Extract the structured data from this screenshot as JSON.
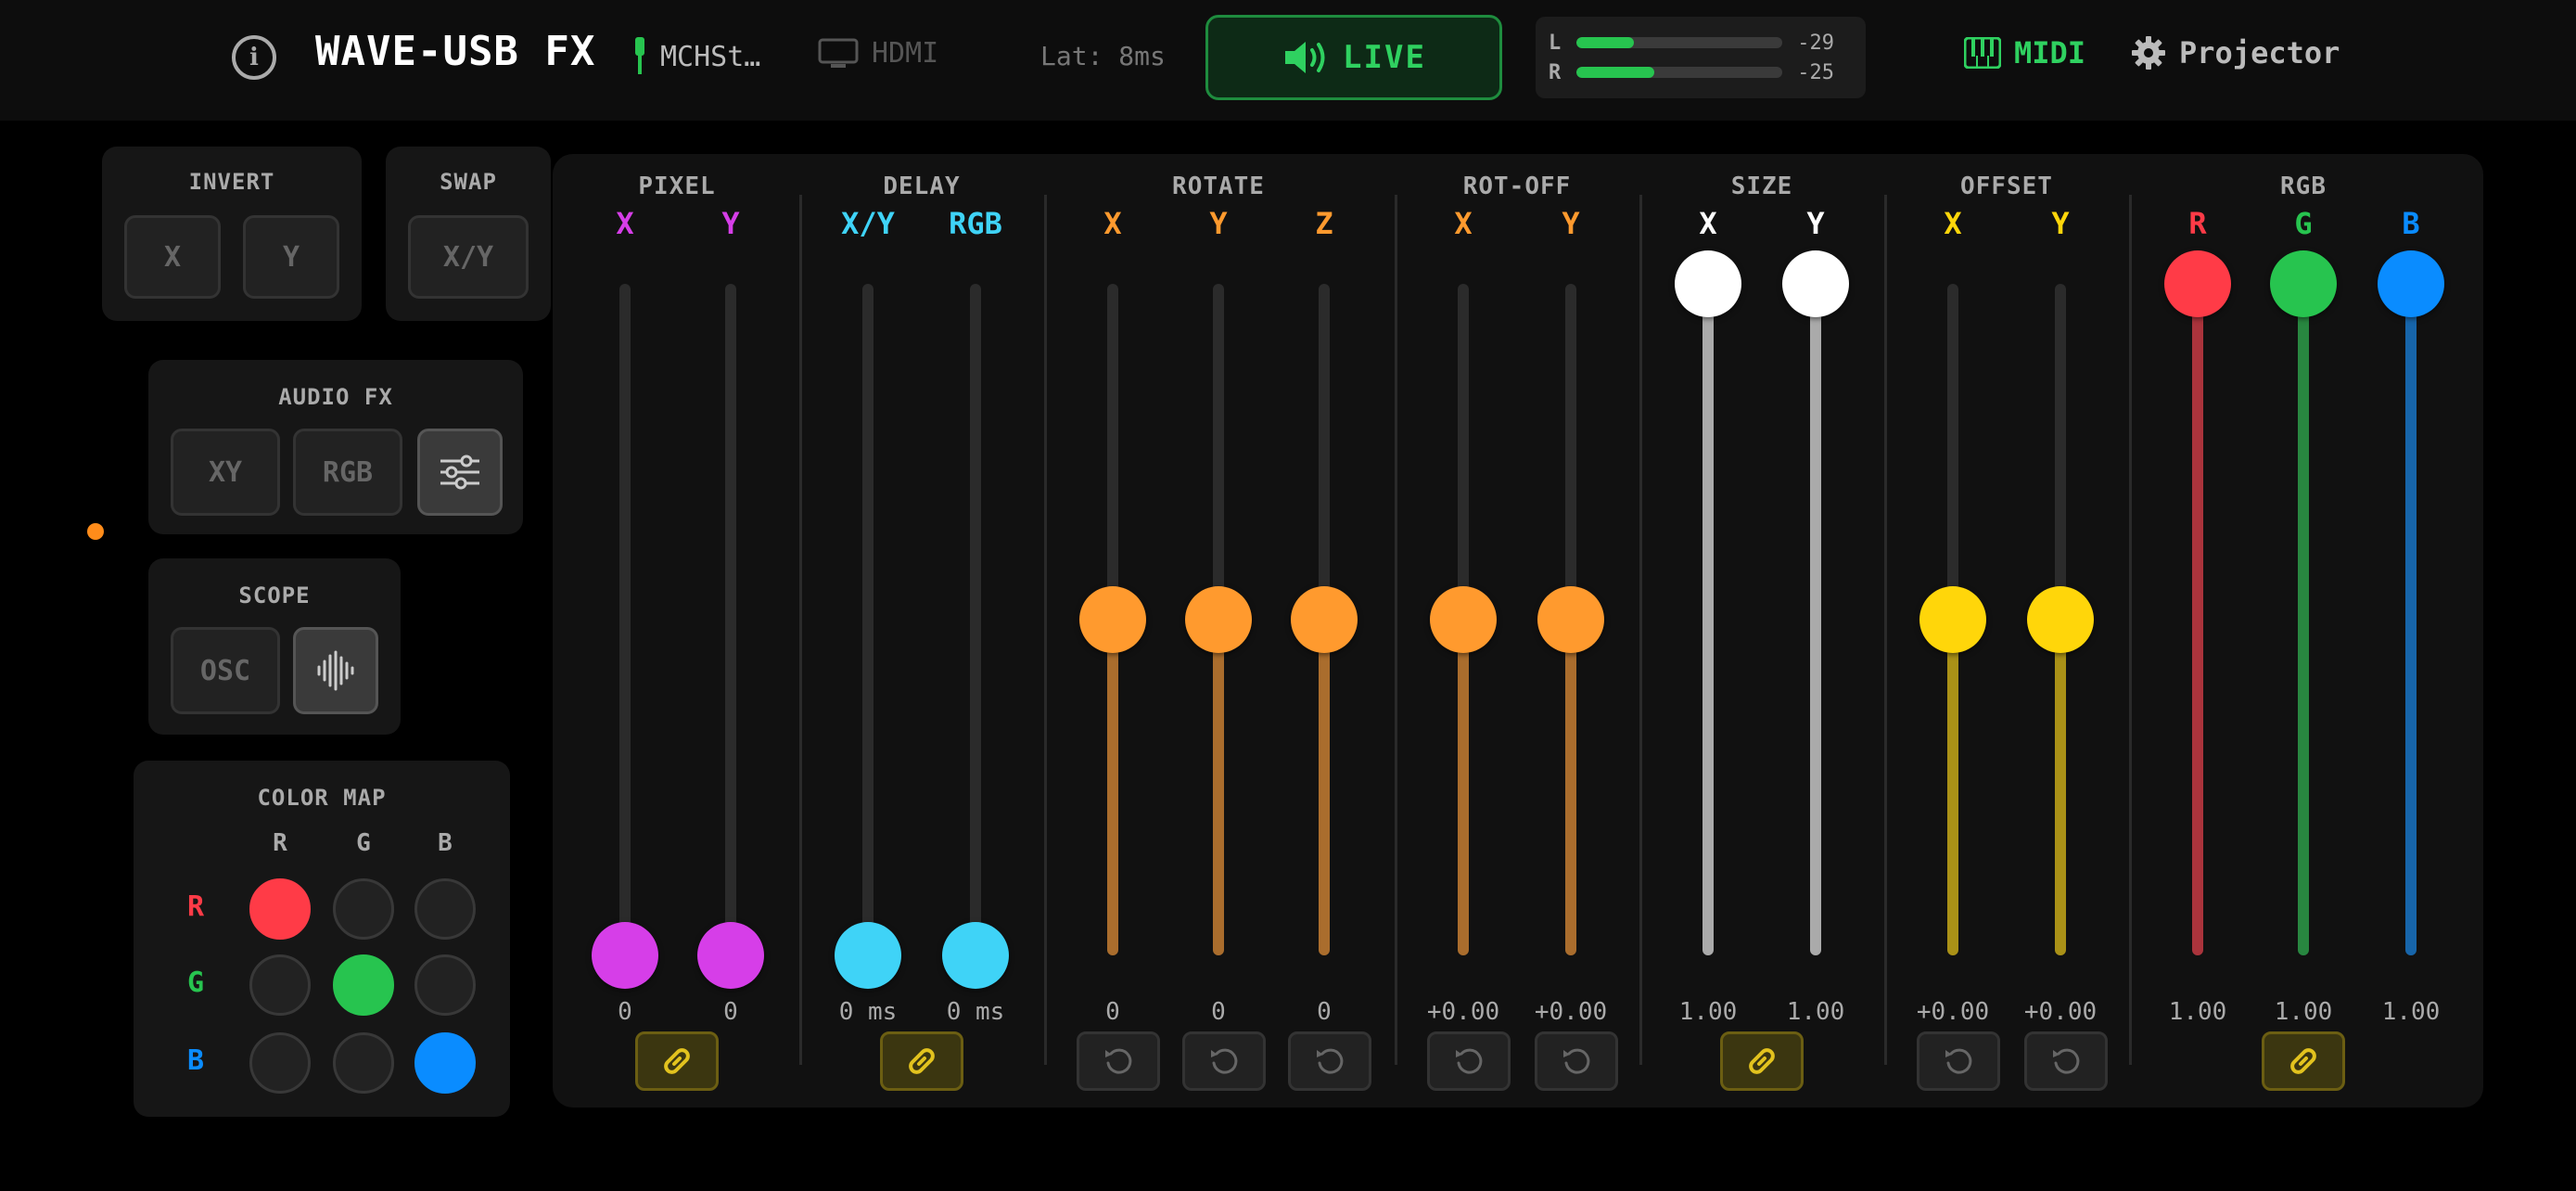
{
  "topbar": {
    "info_icon": "info-icon",
    "title": "WAVE-USB FX",
    "audio_device": "MCHSt…",
    "video_device": "HDMI",
    "latency": "Lat: 8ms",
    "live_label": "LIVE",
    "meters": [
      {
        "channel": "L",
        "level_db": "-29",
        "level_fraction": 0.28
      },
      {
        "channel": "R",
        "level_db": "-25",
        "level_fraction": 0.38
      }
    ],
    "midi_label": "MIDI",
    "projector_label": "Projector"
  },
  "invert": {
    "title": "INVERT",
    "buttons": [
      "X",
      "Y"
    ]
  },
  "swap": {
    "title": "SWAP",
    "button": "X/Y"
  },
  "audio_fx": {
    "title": "AUDIO FX",
    "buttons": [
      "XY",
      "RGB"
    ],
    "settings_icon": "sliders-icon",
    "settings_active": true
  },
  "scope": {
    "title": "SCOPE",
    "button": "OSC",
    "wave_icon": "waveform-icon",
    "wave_active": true
  },
  "color_map": {
    "title": "COLOR MAP",
    "columns": [
      "R",
      "G",
      "B"
    ],
    "rows": [
      "R",
      "G",
      "B"
    ],
    "colors": {
      "R": "#ff3b47",
      "G": "#27c44f",
      "B": "#0a8cff"
    },
    "active": [
      [
        1,
        0,
        0
      ],
      [
        0,
        1,
        0
      ],
      [
        0,
        0,
        1
      ]
    ]
  },
  "mixer": {
    "groups": [
      {
        "title": "PIXEL",
        "channels": [
          {
            "label": "X",
            "value": "0",
            "level": 0.0
          },
          {
            "label": "Y",
            "value": "0",
            "level": 0.0
          }
        ],
        "color": "#d63ee8",
        "footer": "link"
      },
      {
        "title": "DELAY",
        "channels": [
          {
            "label": "X/Y",
            "value": "0 ms",
            "level": 0.0
          },
          {
            "label": "RGB",
            "value": "0 ms",
            "level": 0.0
          }
        ],
        "color": "#3fd3f7",
        "footer": "link"
      },
      {
        "title": "ROTATE",
        "channels": [
          {
            "label": "X",
            "value": "0",
            "level": 0.5
          },
          {
            "label": "Y",
            "value": "0",
            "level": 0.5
          },
          {
            "label": "Z",
            "value": "0",
            "level": 0.5
          }
        ],
        "color": "#ff9a2e",
        "footer": "reset"
      },
      {
        "title": "ROT-OFF",
        "channels": [
          {
            "label": "X",
            "value": "+0.00",
            "level": 0.5
          },
          {
            "label": "Y",
            "value": "+0.00",
            "level": 0.5
          }
        ],
        "color": "#ff9a2e",
        "footer": "reset"
      },
      {
        "title": "SIZE",
        "channels": [
          {
            "label": "X",
            "value": "1.00",
            "level": 1.0
          },
          {
            "label": "Y",
            "value": "1.00",
            "level": 1.0
          }
        ],
        "color": "#ffffff",
        "footer": "link"
      },
      {
        "title": "OFFSET",
        "channels": [
          {
            "label": "X",
            "value": "+0.00",
            "level": 0.5
          },
          {
            "label": "Y",
            "value": "+0.00",
            "level": 0.5
          }
        ],
        "color": "#ffd60a",
        "footer": "reset"
      },
      {
        "title": "RGB",
        "channels": [
          {
            "label": "R",
            "value": "1.00",
            "level": 1.0,
            "color": "#ff3b47"
          },
          {
            "label": "G",
            "value": "1.00",
            "level": 1.0,
            "color": "#27c44f"
          },
          {
            "label": "B",
            "value": "1.00",
            "level": 1.0,
            "color": "#0a8cff"
          }
        ],
        "color": "#ffffff",
        "footer": "link"
      }
    ]
  }
}
